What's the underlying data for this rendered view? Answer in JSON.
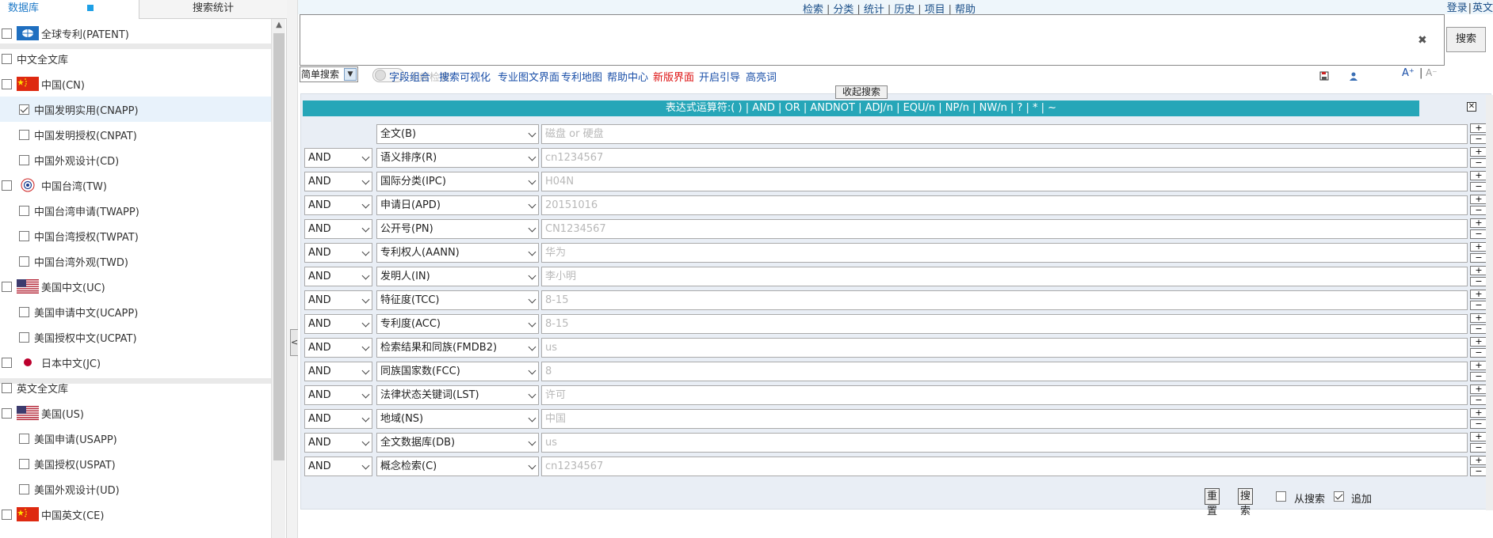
{
  "left_panel": {
    "tabs": {
      "database": "数据库",
      "search_stats": "搜索统计"
    },
    "items": [
      {
        "label": "全球专利(PATENT)",
        "level": 0,
        "checked": false,
        "flag": "globe-flag"
      },
      {
        "label": "中文全文库",
        "level": 0,
        "checked": false,
        "flag": ""
      },
      {
        "label": "中国(CN)",
        "level": 0,
        "checked": false,
        "flag": "china-flag"
      },
      {
        "label": "中国发明实用(CNAPP)",
        "level": 1,
        "checked": true,
        "flag": ""
      },
      {
        "label": "中国发明授权(CNPAT)",
        "level": 1,
        "checked": false,
        "flag": ""
      },
      {
        "label": "中国外观设计(CD)",
        "level": 1,
        "checked": false,
        "flag": ""
      },
      {
        "label": "中国台湾(TW)",
        "level": 0,
        "checked": false,
        "flag": "taiwan-emblem"
      },
      {
        "label": "中国台湾申请(TWAPP)",
        "level": 1,
        "checked": false,
        "flag": ""
      },
      {
        "label": "中国台湾授权(TWPAT)",
        "level": 1,
        "checked": false,
        "flag": ""
      },
      {
        "label": "中国台湾外观(TWD)",
        "level": 1,
        "checked": false,
        "flag": ""
      },
      {
        "label": "美国中文(UC)",
        "level": 0,
        "checked": false,
        "flag": "usa-flag"
      },
      {
        "label": "美国申请中文(UCAPP)",
        "level": 1,
        "checked": false,
        "flag": ""
      },
      {
        "label": "美国授权中文(UCPAT)",
        "level": 1,
        "checked": false,
        "flag": ""
      },
      {
        "label": "日本中文(JC)",
        "level": 0,
        "checked": false,
        "flag": "japan-flag"
      },
      {
        "label": "英文全文库",
        "level": 0,
        "checked": false,
        "flag": ""
      },
      {
        "label": "美国(US)",
        "level": 0,
        "checked": false,
        "flag": "usa-flag"
      },
      {
        "label": "美国申请(USAPP)",
        "level": 1,
        "checked": false,
        "flag": ""
      },
      {
        "label": "美国授权(USPAT)",
        "level": 1,
        "checked": false,
        "flag": ""
      },
      {
        "label": "美国外观设计(UD)",
        "level": 1,
        "checked": false,
        "flag": ""
      },
      {
        "label": "中国英文(CE)",
        "level": 0,
        "checked": false,
        "flag": "china-flag"
      }
    ]
  },
  "topnav": {
    "links": [
      "检索",
      "分类",
      "统计",
      "历史",
      "项目",
      "帮助"
    ],
    "login": "登录",
    "english": "英文"
  },
  "search_button": "搜索",
  "toolbar": {
    "mode": "简单搜索",
    "toggle_label": "无痕检索",
    "links": [
      "字段组合",
      "搜索可视化",
      "专业图文界面",
      "专利地图",
      "帮助中心",
      "新版界面",
      "开启引导",
      "高亮词"
    ],
    "font_up": "A⁺",
    "font_sep": "|",
    "font_down": "A⁻"
  },
  "collapse_search": "收起搜索",
  "form": {
    "operators_bar": "表达式运算符:( ) | AND | OR | ANDNOT | ADJ/n | EQU/n | NP/n | NW/n | ? | * | ~",
    "rows": [
      {
        "op": "",
        "field": "全文(B)",
        "placeholder": "磁盘 or 硬盘"
      },
      {
        "op": "AND",
        "field": "语义排序(R)",
        "placeholder": "cn1234567"
      },
      {
        "op": "AND",
        "field": "国际分类(IPC)",
        "placeholder": "H04N"
      },
      {
        "op": "AND",
        "field": "申请日(APD)",
        "placeholder": "20151016"
      },
      {
        "op": "AND",
        "field": "公开号(PN)",
        "placeholder": "CN1234567"
      },
      {
        "op": "AND",
        "field": "专利权人(AANN)",
        "placeholder": "华为"
      },
      {
        "op": "AND",
        "field": "发明人(IN)",
        "placeholder": "李小明"
      },
      {
        "op": "AND",
        "field": "特征度(TCC)",
        "placeholder": "8-15"
      },
      {
        "op": "AND",
        "field": "专利度(ACC)",
        "placeholder": "8-15"
      },
      {
        "op": "AND",
        "field": "检索结果和同族(FMDB2)",
        "placeholder": "us"
      },
      {
        "op": "AND",
        "field": "同族国家数(FCC)",
        "placeholder": "8"
      },
      {
        "op": "AND",
        "field": "法律状态关键词(LST)",
        "placeholder": "许可"
      },
      {
        "op": "AND",
        "field": "地域(NS)",
        "placeholder": "中国"
      },
      {
        "op": "AND",
        "field": "全文数据库(DB)",
        "placeholder": "us"
      },
      {
        "op": "AND",
        "field": "概念检索(C)",
        "placeholder": "cn1234567"
      }
    ],
    "plus": "+",
    "minus": "−",
    "actions": {
      "reset": "重置",
      "search": "搜索",
      "from_search": "从搜索",
      "from_search_checked": false,
      "append": "追加",
      "append_checked": true
    }
  },
  "colors": {
    "ops_bar_bg": "#26a6b8",
    "link": "#1a4fa8",
    "new_ui_link": "#d11111",
    "form_bg": "#e9eef5"
  }
}
